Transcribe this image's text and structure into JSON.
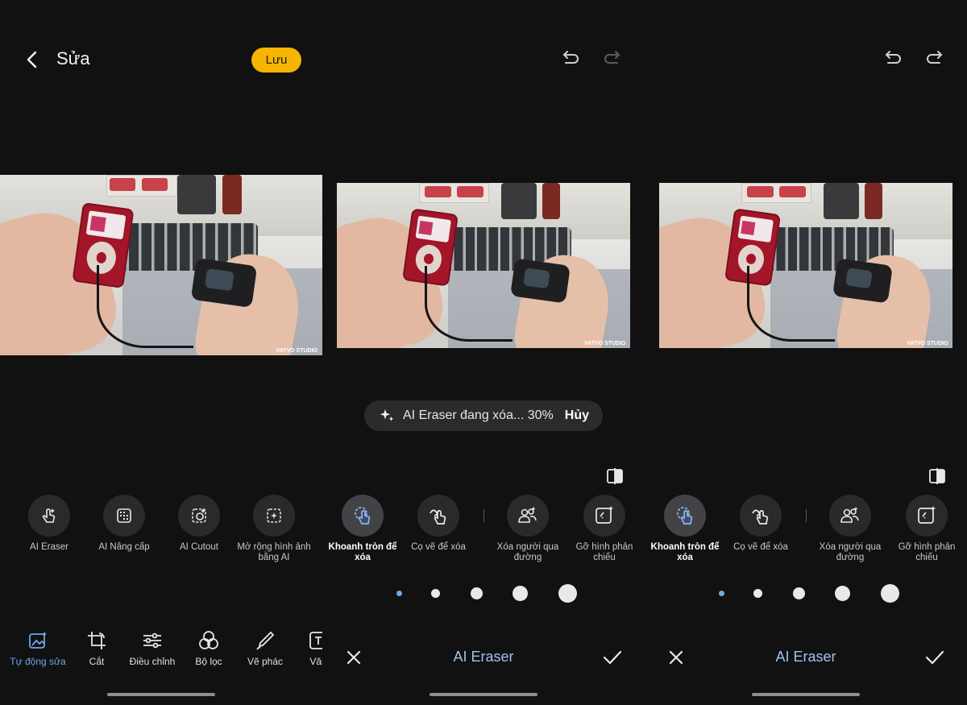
{
  "panel1": {
    "title": "Sửa",
    "save_label": "Lưu",
    "tools": [
      {
        "label": "AI Eraser",
        "icon": "ai-eraser-icon"
      },
      {
        "label": "AI Nâng cấp",
        "icon": "ai-upscale-icon"
      },
      {
        "label": "AI Cutout",
        "icon": "ai-cutout-icon"
      },
      {
        "label": "Mở rộng hình ảnh bằng AI",
        "icon": "ai-expand-icon"
      }
    ],
    "bottom_tools": [
      {
        "label": "Tự động sửa",
        "icon": "auto-fix-icon"
      },
      {
        "label": "Cắt",
        "icon": "crop-icon"
      },
      {
        "label": "Điều chỉnh",
        "icon": "adjust-icon"
      },
      {
        "label": "Bộ lọc",
        "icon": "filter-icon"
      },
      {
        "label": "Vẽ phác",
        "icon": "brush-icon"
      },
      {
        "label": "Văn",
        "icon": "text-icon"
      }
    ],
    "photo_watermark": "VATVO STUDIO"
  },
  "panel2": {
    "progress_text": "AI Eraser đang xóa... 30%",
    "cancel_label": "Hủy",
    "tools": [
      {
        "label": "Khoanh tròn để xóa",
        "icon": "circle-select-icon"
      },
      {
        "label": "Cọ vẽ để xóa",
        "icon": "brush-erase-icon"
      },
      {
        "label": "Xóa người qua đường",
        "icon": "remove-people-icon"
      },
      {
        "label": "Gỡ hình phản chiếu",
        "icon": "remove-reflection-icon"
      }
    ],
    "mode_title": "AI Eraser",
    "photo_watermark": "VATVO STUDIO"
  },
  "panel3": {
    "tools": [
      {
        "label": "Khoanh tròn để xóa",
        "icon": "circle-select-icon"
      },
      {
        "label": "Cọ vẽ để xóa",
        "icon": "brush-erase-icon"
      },
      {
        "label": "Xóa người qua đường",
        "icon": "remove-people-icon"
      },
      {
        "label": "Gỡ hình phản chiếu",
        "icon": "remove-reflection-icon"
      }
    ],
    "mode_title": "AI Eraser",
    "photo_watermark": "VATVO STUDIO"
  },
  "colors": {
    "background": "#111111",
    "save_button": "#f6b500",
    "accent_blue": "#6fa8e8"
  }
}
